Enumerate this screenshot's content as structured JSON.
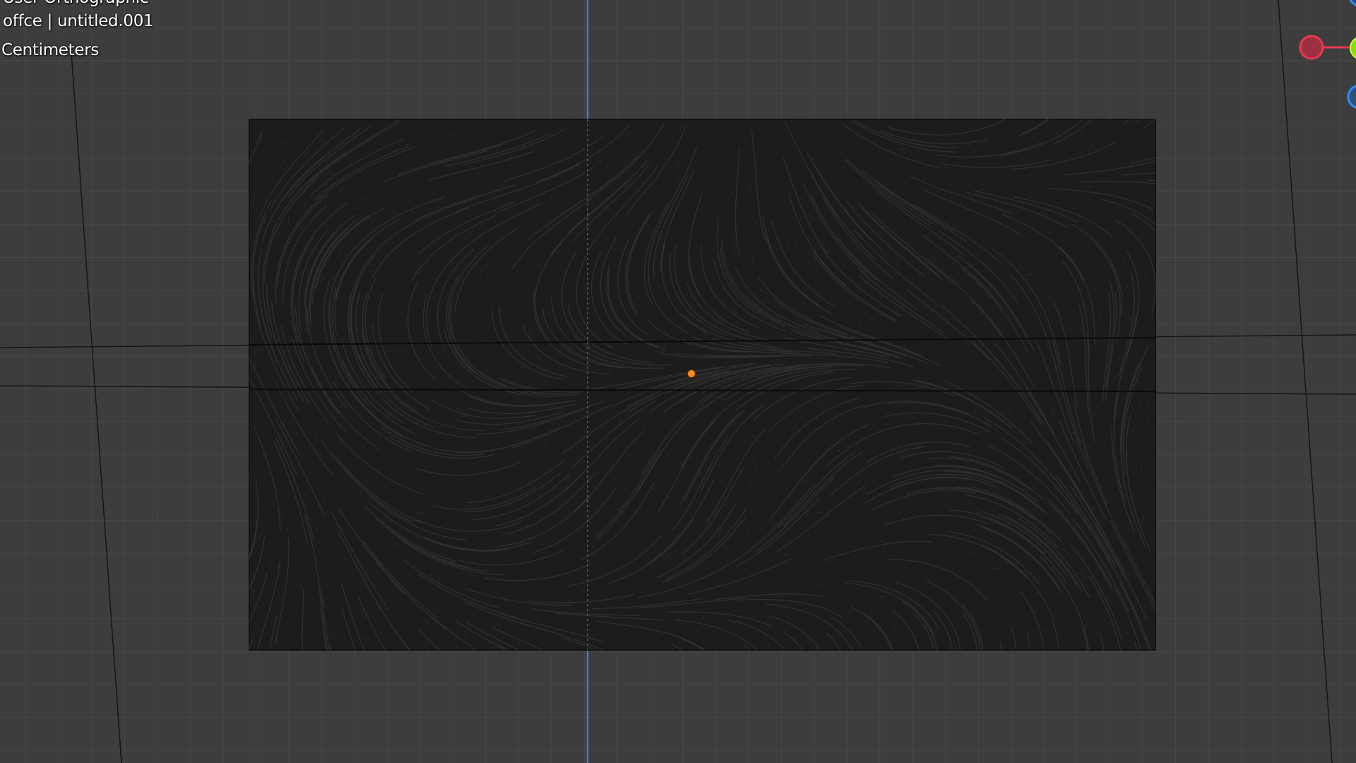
{
  "viewport": {
    "view_label_partial": "User Orthographic",
    "object_info": "offce | untitled.001",
    "units": "Centimeters"
  },
  "navigation_gizmo": {
    "x_axis_color": "#e8394f",
    "y_axis_color": "#8bdc00",
    "z_axis_color": "#2c8fff"
  },
  "colors": {
    "background": "#3d3d3d",
    "grid_line": "#4a4a4a",
    "mesh_fill": "#1c1c1c",
    "wire": "#2e2e2e",
    "z_axis_line": "#3f7fd2",
    "origin_dot": "#ff8a1a"
  }
}
